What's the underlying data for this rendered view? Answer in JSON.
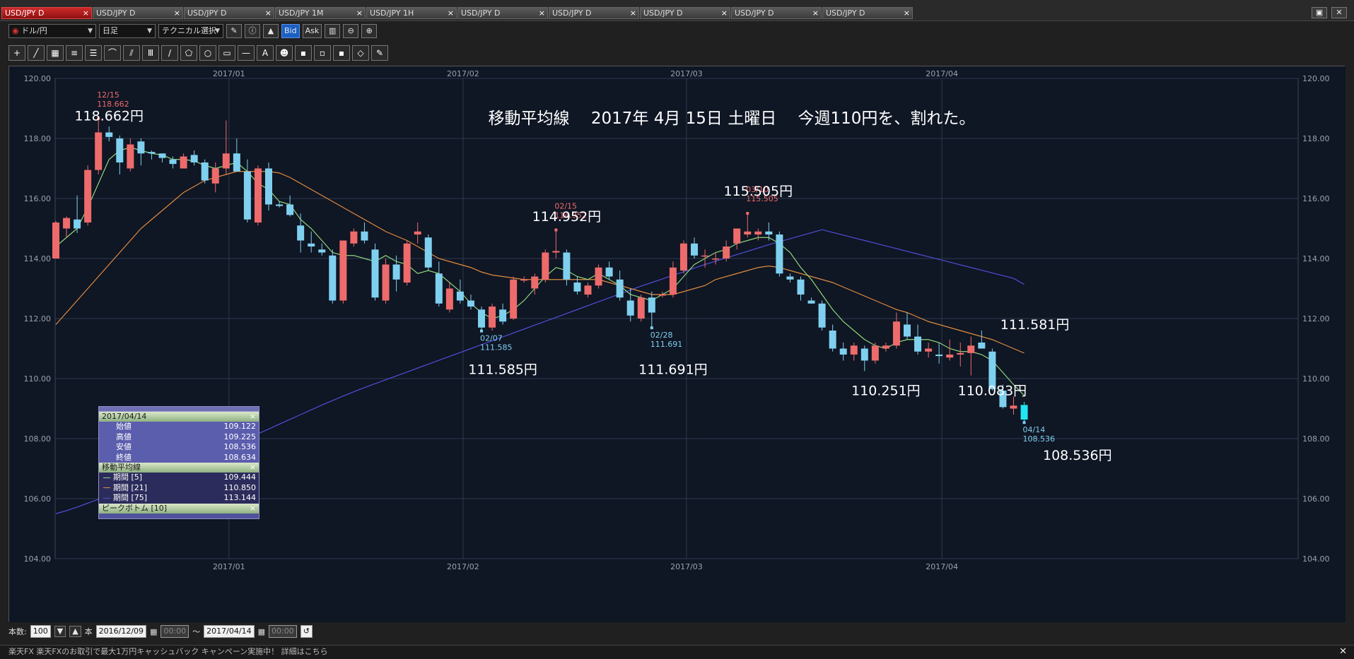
{
  "tabs": [
    {
      "label": "USD/JPY D",
      "active": true
    },
    {
      "label": "USD/JPY D",
      "active": false
    },
    {
      "label": "USD/JPY D",
      "active": false
    },
    {
      "label": "USD/JPY 1M",
      "active": false
    },
    {
      "label": "USD/JPY 1H",
      "active": false
    },
    {
      "label": "USD/JPY D",
      "active": false
    },
    {
      "label": "USD/JPY D",
      "active": false
    },
    {
      "label": "USD/JPY D",
      "active": false
    },
    {
      "label": "USD/JPY D",
      "active": false
    },
    {
      "label": "USD/JPY D",
      "active": false
    }
  ],
  "tab_close_glyph": "×",
  "window_buttons": {
    "restore": "▣",
    "close": "✕"
  },
  "toolbar": {
    "pair": "ドル/円",
    "timeframe": "日足",
    "technical": "テクニカル選択",
    "bid": "Bid",
    "ask": "Ask"
  },
  "drawing_tools": [
    "+",
    "╱",
    "▦",
    "≡",
    "☰",
    "⌒",
    "⫽",
    "Ⅲ",
    "∕",
    "⬠",
    "○",
    "▭",
    "—",
    "A",
    "☻",
    "▪",
    "▫",
    "▪",
    "◇",
    "✎"
  ],
  "chart_data": {
    "type": "candlestick",
    "title": "移動平均線　 2017年 4月 15日 土曜日　 今週110円を、割れた。",
    "ylim": [
      104,
      120
    ],
    "yticks": [
      "120.00",
      "118.00",
      "116.00",
      "114.00",
      "112.00",
      "110.00",
      "108.00",
      "106.00",
      "104.00"
    ],
    "x_month_labels": [
      {
        "label": "2017/01",
        "index": 16
      },
      {
        "label": "2017/02",
        "index": 38
      },
      {
        "label": "2017/03",
        "index": 59
      },
      {
        "label": "2017/04",
        "index": 83
      }
    ],
    "candles": [
      [
        114.0,
        115.25,
        114.0,
        115.2
      ],
      [
        115.0,
        115.4,
        114.7,
        115.35
      ],
      [
        115.3,
        116.1,
        114.85,
        115.0
      ],
      [
        115.2,
        117.1,
        115.1,
        116.95
      ],
      [
        116.95,
        118.65,
        116.8,
        118.2
      ],
      [
        118.2,
        118.4,
        117.9,
        118.05
      ],
      [
        118.0,
        118.1,
        116.8,
        117.2
      ],
      [
        117.0,
        118.0,
        116.9,
        117.8
      ],
      [
        117.9,
        118.0,
        117.1,
        117.5
      ],
      [
        117.55,
        117.6,
        117.3,
        117.5
      ],
      [
        117.5,
        117.5,
        117.2,
        117.35
      ],
      [
        117.3,
        117.4,
        117.0,
        117.15
      ],
      [
        117.0,
        117.5,
        117.0,
        117.4
      ],
      [
        117.45,
        117.6,
        117.1,
        117.2
      ],
      [
        117.2,
        117.3,
        116.5,
        116.6
      ],
      [
        116.5,
        117.2,
        116.2,
        117.0
      ],
      [
        117.0,
        118.6,
        116.8,
        117.5
      ],
      [
        117.5,
        118.0,
        117.0,
        116.9
      ],
      [
        116.9,
        117.3,
        115.2,
        115.3
      ],
      [
        115.2,
        117.1,
        115.1,
        117.0
      ],
      [
        117.0,
        117.2,
        115.6,
        115.8
      ],
      [
        115.8,
        115.9,
        115.7,
        115.75
      ],
      [
        115.8,
        116.1,
        115.4,
        115.45
      ],
      [
        115.1,
        115.5,
        114.2,
        114.6
      ],
      [
        114.5,
        114.9,
        114.2,
        114.4
      ],
      [
        114.3,
        114.5,
        114.1,
        114.2
      ],
      [
        114.1,
        114.3,
        112.5,
        112.6
      ],
      [
        112.6,
        114.6,
        112.5,
        114.6
      ],
      [
        114.5,
        115.0,
        114.4,
        114.9
      ],
      [
        114.9,
        115.2,
        114.5,
        114.6
      ],
      [
        114.3,
        114.5,
        112.6,
        112.7
      ],
      [
        112.6,
        114.0,
        112.5,
        113.8
      ],
      [
        113.8,
        114.1,
        112.9,
        113.3
      ],
      [
        113.2,
        114.6,
        113.1,
        114.5
      ],
      [
        114.8,
        115.2,
        114.5,
        114.9
      ],
      [
        114.7,
        114.8,
        113.6,
        113.7
      ],
      [
        113.5,
        113.9,
        112.4,
        112.5
      ],
      [
        112.3,
        113.2,
        112.2,
        113.0
      ],
      [
        112.9,
        113.3,
        112.5,
        112.6
      ],
      [
        112.6,
        112.8,
        112.3,
        112.4
      ],
      [
        112.3,
        112.4,
        111.58,
        111.7
      ],
      [
        111.7,
        112.5,
        111.6,
        112.4
      ],
      [
        112.3,
        112.5,
        111.8,
        111.9
      ],
      [
        112.0,
        113.4,
        111.95,
        113.3
      ],
      [
        113.3,
        113.4,
        113.2,
        113.3
      ],
      [
        113.0,
        113.5,
        112.8,
        113.4
      ],
      [
        113.3,
        114.3,
        113.2,
        114.2
      ],
      [
        114.2,
        114.95,
        114.0,
        114.25
      ],
      [
        114.2,
        114.3,
        113.1,
        113.3
      ],
      [
        113.2,
        113.4,
        112.8,
        112.9
      ],
      [
        112.8,
        113.2,
        112.7,
        113.1
      ],
      [
        113.1,
        113.8,
        113.0,
        113.7
      ],
      [
        113.7,
        113.9,
        113.3,
        113.4
      ],
      [
        113.3,
        113.6,
        112.6,
        112.7
      ],
      [
        112.6,
        113.0,
        111.9,
        112.1
      ],
      [
        112.0,
        112.8,
        111.9,
        112.7
      ],
      [
        112.7,
        112.9,
        111.7,
        112.2
      ],
      [
        112.8,
        112.9,
        112.7,
        112.8
      ],
      [
        112.8,
        113.9,
        112.7,
        113.7
      ],
      [
        113.6,
        114.6,
        113.5,
        114.5
      ],
      [
        114.5,
        114.7,
        114.0,
        114.1
      ],
      [
        114.1,
        114.3,
        113.7,
        114.1
      ],
      [
        114.0,
        114.2,
        113.8,
        114.0
      ],
      [
        114.0,
        114.6,
        113.9,
        114.4
      ],
      [
        114.5,
        115.0,
        114.3,
        115.0
      ],
      [
        114.8,
        115.51,
        114.7,
        114.9
      ],
      [
        114.8,
        115.0,
        114.6,
        114.9
      ],
      [
        114.9,
        115.2,
        114.6,
        114.8
      ],
      [
        114.8,
        114.9,
        113.4,
        113.5
      ],
      [
        113.4,
        113.5,
        113.2,
        113.3
      ],
      [
        113.3,
        113.4,
        112.6,
        112.8
      ],
      [
        112.6,
        112.7,
        112.5,
        112.5
      ],
      [
        112.5,
        112.6,
        111.6,
        111.7
      ],
      [
        111.6,
        111.8,
        110.9,
        111.0
      ],
      [
        111.0,
        111.2,
        110.6,
        110.8
      ],
      [
        110.8,
        111.2,
        110.6,
        111.1
      ],
      [
        111.0,
        111.1,
        110.25,
        110.6
      ],
      [
        110.6,
        111.2,
        110.5,
        111.1
      ],
      [
        111.0,
        111.2,
        110.9,
        111.1
      ],
      [
        111.1,
        112.2,
        111.0,
        111.9
      ],
      [
        111.8,
        112.2,
        111.3,
        111.4
      ],
      [
        111.4,
        111.8,
        110.8,
        110.9
      ],
      [
        110.9,
        111.2,
        110.7,
        111.0
      ],
      [
        110.8,
        111.2,
        110.5,
        110.75
      ],
      [
        110.7,
        111.3,
        110.6,
        110.8
      ],
      [
        110.8,
        111.2,
        110.4,
        110.85
      ],
      [
        110.85,
        111.4,
        110.1,
        111.1
      ],
      [
        111.2,
        111.6,
        111.0,
        111.0
      ],
      [
        110.9,
        111.0,
        109.6,
        109.65
      ],
      [
        109.6,
        109.8,
        109.0,
        109.05
      ],
      [
        109.0,
        109.4,
        108.8,
        109.1
      ],
      [
        109.122,
        109.225,
        108.536,
        108.634
      ]
    ],
    "ma5": [
      114.4,
      114.7,
      115.0,
      115.7,
      116.5,
      117.3,
      117.6,
      117.7,
      117.6,
      117.5,
      117.45,
      117.3,
      117.3,
      117.25,
      117.1,
      117.0,
      117.1,
      117.2,
      116.9,
      116.5,
      116.3,
      115.9,
      115.8,
      115.3,
      115.0,
      114.6,
      114.2,
      114.1,
      114.1,
      114.0,
      113.9,
      114.1,
      113.9,
      113.8,
      113.5,
      113.6,
      113.5,
      113.2,
      112.9,
      112.5,
      112.2,
      112.0,
      112.1,
      112.3,
      112.6,
      113.0,
      113.4,
      113.7,
      113.6,
      113.4,
      113.3,
      113.5,
      113.3,
      113.1,
      112.8,
      112.7,
      112.6,
      112.8,
      113.0,
      113.4,
      113.8,
      114.0,
      114.2,
      114.3,
      114.5,
      114.6,
      114.7,
      114.7,
      114.5,
      114.2,
      113.7,
      113.3,
      112.8,
      112.3,
      111.9,
      111.6,
      111.3,
      111.1,
      111.0,
      111.2,
      111.3,
      111.3,
      111.3,
      111.2,
      111.0,
      110.9,
      110.9,
      110.8,
      110.6,
      110.2,
      109.8,
      109.44
    ],
    "ma21": [
      111.8,
      112.2,
      112.6,
      113.0,
      113.4,
      113.8,
      114.2,
      114.6,
      115.0,
      115.3,
      115.6,
      115.9,
      116.2,
      116.4,
      116.6,
      116.7,
      116.8,
      116.9,
      116.9,
      116.9,
      116.9,
      116.85,
      116.7,
      116.5,
      116.3,
      116.1,
      115.9,
      115.7,
      115.5,
      115.3,
      115.1,
      114.9,
      114.75,
      114.6,
      114.4,
      114.2,
      114.0,
      113.9,
      113.8,
      113.7,
      113.55,
      113.45,
      113.4,
      113.35,
      113.3,
      113.3,
      113.3,
      113.3,
      113.3,
      113.3,
      113.3,
      113.3,
      113.2,
      113.1,
      113.0,
      112.9,
      112.8,
      112.8,
      112.8,
      112.9,
      113.0,
      113.1,
      113.3,
      113.4,
      113.5,
      113.6,
      113.7,
      113.75,
      113.7,
      113.6,
      113.5,
      113.4,
      113.3,
      113.2,
      113.05,
      112.9,
      112.75,
      112.6,
      112.45,
      112.3,
      112.2,
      112.05,
      111.9,
      111.8,
      111.7,
      111.6,
      111.5,
      111.4,
      111.3,
      111.15,
      111.0,
      110.85
    ],
    "ma75": [
      105.5,
      105.6,
      105.72,
      105.85,
      105.98,
      106.1,
      106.23,
      106.37,
      106.5,
      106.63,
      106.78,
      106.93,
      107.08,
      107.23,
      107.38,
      107.53,
      107.68,
      107.84,
      108.0,
      108.16,
      108.32,
      108.48,
      108.64,
      108.8,
      108.96,
      109.12,
      109.27,
      109.42,
      109.56,
      109.7,
      109.83,
      109.96,
      110.09,
      110.22,
      110.35,
      110.48,
      110.61,
      110.74,
      110.87,
      111.0,
      111.13,
      111.26,
      111.39,
      111.52,
      111.65,
      111.78,
      111.91,
      112.04,
      112.17,
      112.3,
      112.43,
      112.56,
      112.69,
      112.82,
      112.95,
      113.08,
      113.2,
      113.32,
      113.44,
      113.56,
      113.68,
      113.8,
      113.91,
      114.02,
      114.13,
      114.24,
      114.35,
      114.46,
      114.56,
      114.66,
      114.76,
      114.86,
      114.96,
      115.05,
      115.14,
      115.23,
      115.32,
      115.4,
      115.48,
      115.56,
      115.63,
      115.7,
      115.76,
      115.82,
      115.87,
      115.92,
      115.96,
      116.0,
      116.03,
      116.06,
      116.09,
      113.14
    ],
    "peaks": [
      {
        "index": 4,
        "date": "12/15",
        "value": "118.662",
        "kind": "high"
      },
      {
        "index": 40,
        "date": "02/07",
        "value": "111.585",
        "kind": "low"
      },
      {
        "index": 47,
        "date": "02/15",
        "value": "114.952",
        "kind": "high"
      },
      {
        "index": 56,
        "date": "02/28",
        "value": "111.691",
        "kind": "low"
      },
      {
        "index": 65,
        "date": "03/10",
        "value": "115.505",
        "kind": "high"
      },
      {
        "index": 91,
        "date": "04/14",
        "value": "108.536",
        "kind": "low"
      }
    ],
    "annotations": [
      {
        "text": "118.662円",
        "y": 118.6,
        "x_index": 5
      },
      {
        "text": "114.952円",
        "y": 115.25,
        "x_index": 48
      },
      {
        "text": "115.505円",
        "y": 116.1,
        "x_index": 66
      },
      {
        "text": "111.585円",
        "y": 110.15,
        "x_index": 42
      },
      {
        "text": "111.691円",
        "y": 110.15,
        "x_index": 58
      },
      {
        "text": "110.251円",
        "y": 109.45,
        "x_index": 78
      },
      {
        "text": "110.083円",
        "y": 109.45,
        "x_index": 88
      },
      {
        "text": "111.581円",
        "y": 111.65,
        "x_index": 92
      },
      {
        "text": "108.536円",
        "y": 107.3,
        "x_index": 96
      }
    ],
    "colors": {
      "up": "#ee6b6b",
      "down": "#7fd0ef",
      "ma5": "#8fd67a",
      "ma21": "#e08c3e",
      "ma75": "#4f4fd8",
      "last": "#22e4f2",
      "grid": "#2e3a4f",
      "bg": "#0f1624"
    }
  },
  "data_window": {
    "date": "2017/04/14",
    "close_glyph": "×",
    "rows": [
      {
        "label": "始値",
        "value": "109.122"
      },
      {
        "label": "高値",
        "value": "109.225"
      },
      {
        "label": "安値",
        "value": "108.536"
      },
      {
        "label": "終値",
        "value": "108.634"
      }
    ],
    "ma_title": "移動平均線",
    "ma_rows": [
      {
        "label": "期間 [5]",
        "value": "109.444",
        "color": "#8fd67a"
      },
      {
        "label": "期間 [21]",
        "value": "110.850",
        "color": "#e08c3e"
      },
      {
        "label": "期間 [75]",
        "value": "113.144",
        "color": "#4f4fd8"
      }
    ],
    "peak_title": "ピークボトム [10]"
  },
  "bottombar": {
    "count_label": "本数:",
    "count_value": "100",
    "unit": "本",
    "start_date": "2016/12/09",
    "start_time": "00:00",
    "tilde": "〜",
    "end_date": "2017/04/14",
    "end_time": "00:00"
  },
  "status": {
    "text": "楽天FX 楽天FXのお取引で最大1万円キャッシュバック キャンペーン実施中！ 詳細はこちら",
    "close_glyph": "✕"
  }
}
